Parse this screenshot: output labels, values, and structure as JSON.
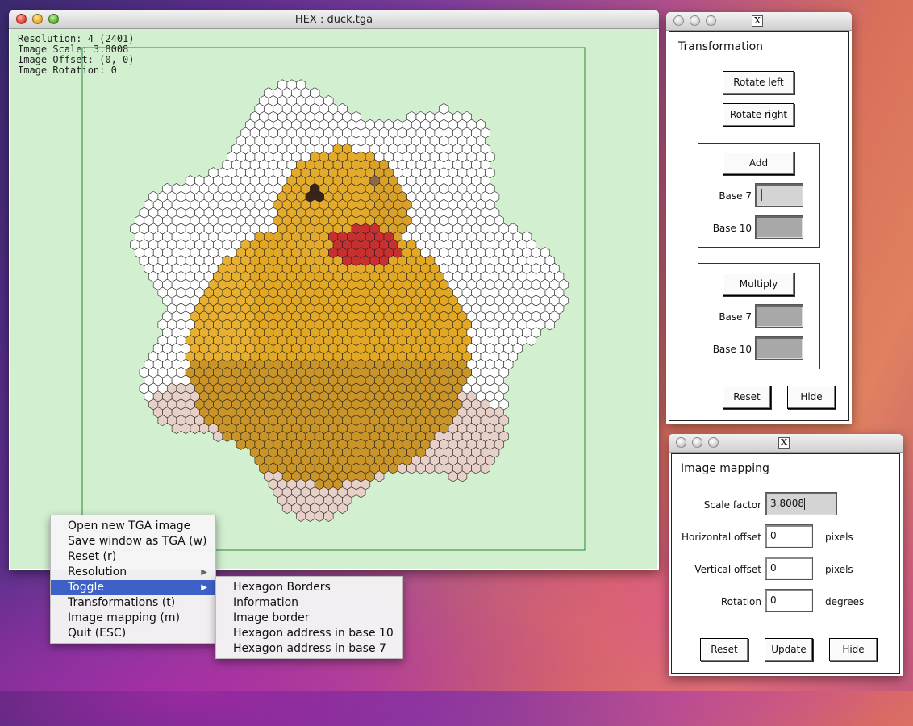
{
  "hex_window": {
    "title": "HEX : duck.tga",
    "info": {
      "resolution": "Resolution: 4 (2401)",
      "scale": "Image Scale: 3.8008",
      "offset": "Image Offset: (0, 0)",
      "rotation": "Image Rotation: 0"
    }
  },
  "context_menu": {
    "items": [
      {
        "label": "Open new TGA image"
      },
      {
        "label": "Save window as TGA (w)"
      },
      {
        "label": "Reset (r)"
      },
      {
        "label": "Resolution"
      },
      {
        "label": "Toggle"
      },
      {
        "label": "Transformations (t)"
      },
      {
        "label": "Image mapping (m)"
      },
      {
        "label": "Quit (ESC)"
      }
    ],
    "selected": "Toggle"
  },
  "toggle_submenu": {
    "items": [
      {
        "label": "Hexagon Borders"
      },
      {
        "label": "Information"
      },
      {
        "label": "Image border"
      },
      {
        "label": "Hexagon address in base 10"
      },
      {
        "label": "Hexagon address in base 7"
      }
    ]
  },
  "transformation_window": {
    "close_glyph": "X",
    "heading": "Transformation",
    "rotate_left": "Rotate left",
    "rotate_right": "Rotate right",
    "add": {
      "button": "Add",
      "base7_label": "Base 7",
      "base7_value": "",
      "base10_label": "Base 10",
      "base10_value": ""
    },
    "multiply": {
      "button": "Multiply",
      "base7_label": "Base 7",
      "base7_value": "",
      "base10_label": "Base 10",
      "base10_value": ""
    },
    "reset": "Reset",
    "hide": "Hide"
  },
  "mapping_window": {
    "close_glyph": "X",
    "heading": "Image mapping",
    "scale_label": "Scale factor",
    "scale_value": "3.8008",
    "hoffset_label": "Horizontal offset",
    "hoffset_value": "0",
    "hoffset_unit": "pixels",
    "voffset_label": "Vertical offset",
    "voffset_value": "0",
    "voffset_unit": "pixels",
    "rotation_label": "Rotation",
    "rotation_value": "0",
    "rotation_unit": "degrees",
    "reset": "Reset",
    "update": "Update",
    "hide": "Hide"
  },
  "colors": {
    "canvas_bg": "#d2efd0",
    "menu_highlight": "#3e61c8",
    "duck_body": "#e2a824",
    "beak": "#c83030"
  }
}
